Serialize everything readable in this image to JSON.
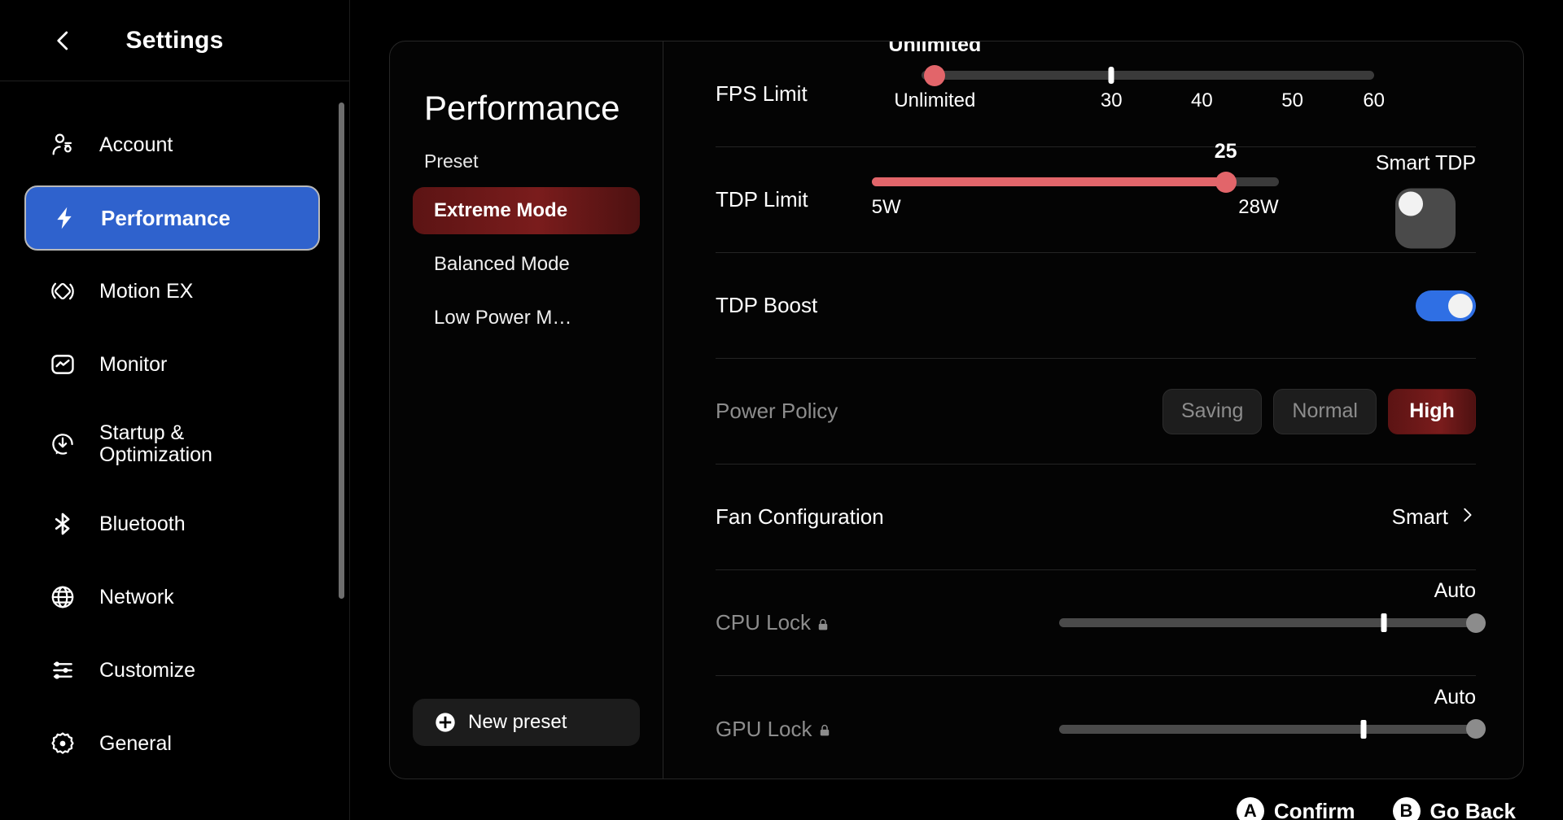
{
  "sidebar": {
    "title": "Settings",
    "back_icon": "chevron-left-icon",
    "items": [
      {
        "label": "Account",
        "icon": "account-icon",
        "active": false
      },
      {
        "label": "Performance",
        "icon": "lightning-icon",
        "active": true
      },
      {
        "label": "Motion EX",
        "icon": "motion-icon",
        "active": false
      },
      {
        "label": "Monitor",
        "icon": "monitor-icon",
        "active": false
      },
      {
        "label": "Startup &\nOptimization",
        "icon": "startup-icon",
        "active": false
      },
      {
        "label": "Bluetooth",
        "icon": "bluetooth-icon",
        "active": false
      },
      {
        "label": "Network",
        "icon": "globe-icon",
        "active": false
      },
      {
        "label": "Customize",
        "icon": "sliders-icon",
        "active": false
      },
      {
        "label": "General",
        "icon": "gear-icon",
        "active": false
      }
    ]
  },
  "panel": {
    "title": "Performance",
    "preset_label": "Preset",
    "presets": [
      {
        "label": "Extreme Mode",
        "active": true
      },
      {
        "label": "Balanced Mode",
        "active": false
      },
      {
        "label": "Low Power M…",
        "active": false
      }
    ],
    "new_preset": {
      "label": "New preset",
      "icon": "plus-circle-icon"
    }
  },
  "settings": {
    "fps_limit": {
      "label": "FPS Limit",
      "value_text": "Unlimited",
      "value_pos_pct": 3,
      "tick_pos_pct": 42,
      "tick_labels": [
        "Unlimited",
        "30",
        "40",
        "50",
        "60"
      ],
      "tick_label_pos_pct": [
        3,
        42,
        62,
        82,
        100
      ]
    },
    "tdp_limit": {
      "label": "TDP Limit",
      "value_text": "25",
      "value_pos_pct": 87,
      "fill_pct": 87,
      "min_label": "5W",
      "max_label": "28W"
    },
    "smart_tdp": {
      "label": "Smart TDP",
      "state": "off"
    },
    "tdp_boost": {
      "label": "TDP Boost",
      "state": "on"
    },
    "power_policy": {
      "label": "Power Policy",
      "options": [
        {
          "label": "Saving",
          "active": false
        },
        {
          "label": "Normal",
          "active": false
        },
        {
          "label": "High",
          "active": true
        }
      ]
    },
    "fan_configuration": {
      "label": "Fan Configuration",
      "value": "Smart",
      "chevron": "chevron-right-icon"
    },
    "cpu_lock": {
      "label": "CPU Lock",
      "lock_icon": "lock-icon",
      "value": "Auto",
      "tick_pos_pct": 78,
      "thumb_pos_pct": 100
    },
    "gpu_lock": {
      "label": "GPU Lock",
      "lock_icon": "lock-icon",
      "value": "Auto",
      "tick_pos_pct": 73,
      "thumb_pos_pct": 100
    }
  },
  "bottom_bar": {
    "hints": [
      {
        "badge": "A",
        "label": "Confirm"
      },
      {
        "badge": "B",
        "label": "Go Back"
      }
    ]
  },
  "colors": {
    "accent_blue": "#2f62cd",
    "accent_red": "#e2656a",
    "preset_red": "#7a1c1c",
    "toggle_on": "#2f6fe4",
    "background": "#000000"
  }
}
